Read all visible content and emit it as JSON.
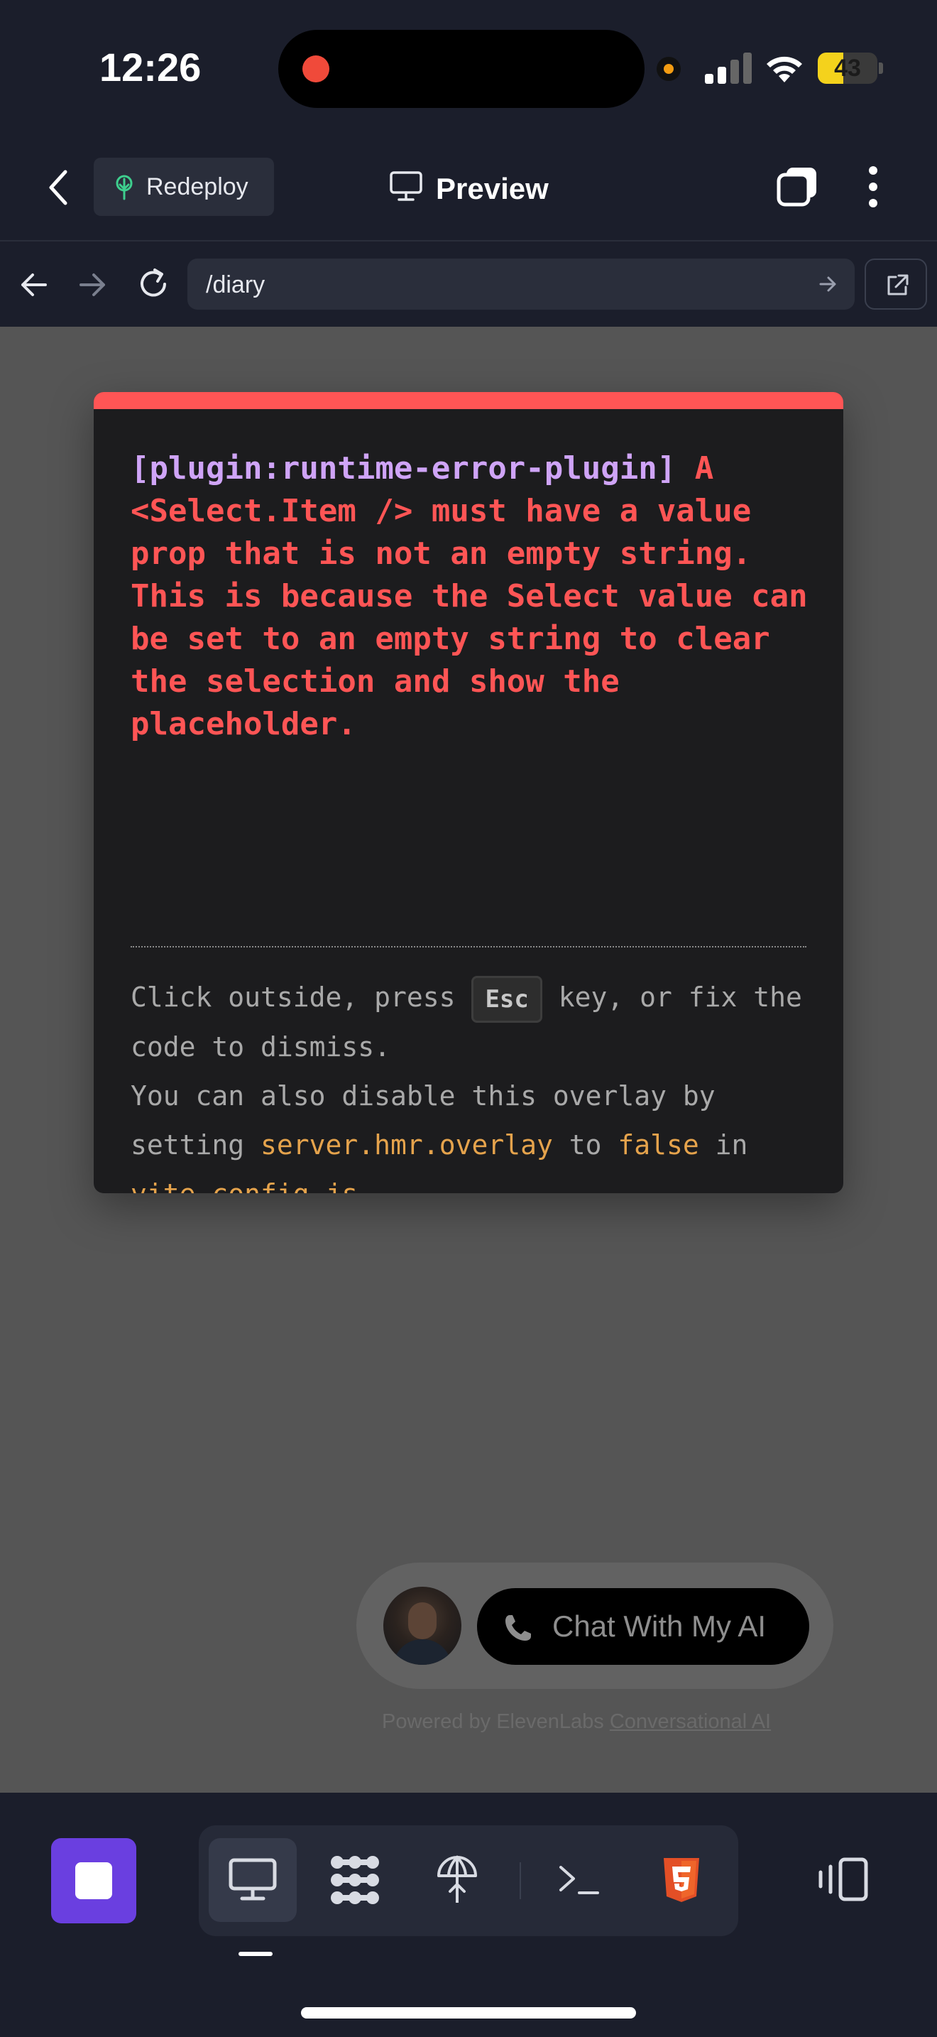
{
  "status_bar": {
    "time": "12:26",
    "battery_percent": "43",
    "battery_level": 0.43
  },
  "app_bar": {
    "redeploy_label": "Redeploy",
    "preview_label": "Preview"
  },
  "browser": {
    "url": "/diary"
  },
  "error_overlay": {
    "plugin_tag": "[plugin:runtime-error-plugin]",
    "message": " A <Select.Item /> must have a value prop that is not an empty string. This is because the Select value can be set to an empty string to clear the selection and show the placeholder.",
    "tip_part1": "Click outside, press ",
    "tip_key": "Esc",
    "tip_part2": " key, or fix the code to dismiss.",
    "tip_part3": "You can also disable this overlay by setting ",
    "tip_code1": "server.hmr.overlay",
    "tip_part4": " to ",
    "tip_code2": "false",
    "tip_part5": " in ",
    "tip_code3": "vite.config.js",
    "tip_part6": "."
  },
  "voice_widget": {
    "chat_label": "Chat With My AI",
    "powered_prefix": "Powered by ElevenLabs ",
    "powered_link": "Conversational AI"
  },
  "colors": {
    "accent_purple": "#6a3fe0",
    "error_red": "#ff5555",
    "plugin_purple": "#cfa4f7",
    "code_orange": "#e5a34c"
  },
  "icons": [
    "chevron-left-icon",
    "tree-icon",
    "monitor-icon",
    "tabs-icon",
    "more-vertical-icon",
    "arrow-left-icon",
    "arrow-right-icon",
    "reload-icon",
    "external-link-icon",
    "phone-icon",
    "stop-icon",
    "grid-dots-icon",
    "deploy-icon",
    "terminal-icon",
    "html5-icon",
    "panel-toggle-icon"
  ]
}
